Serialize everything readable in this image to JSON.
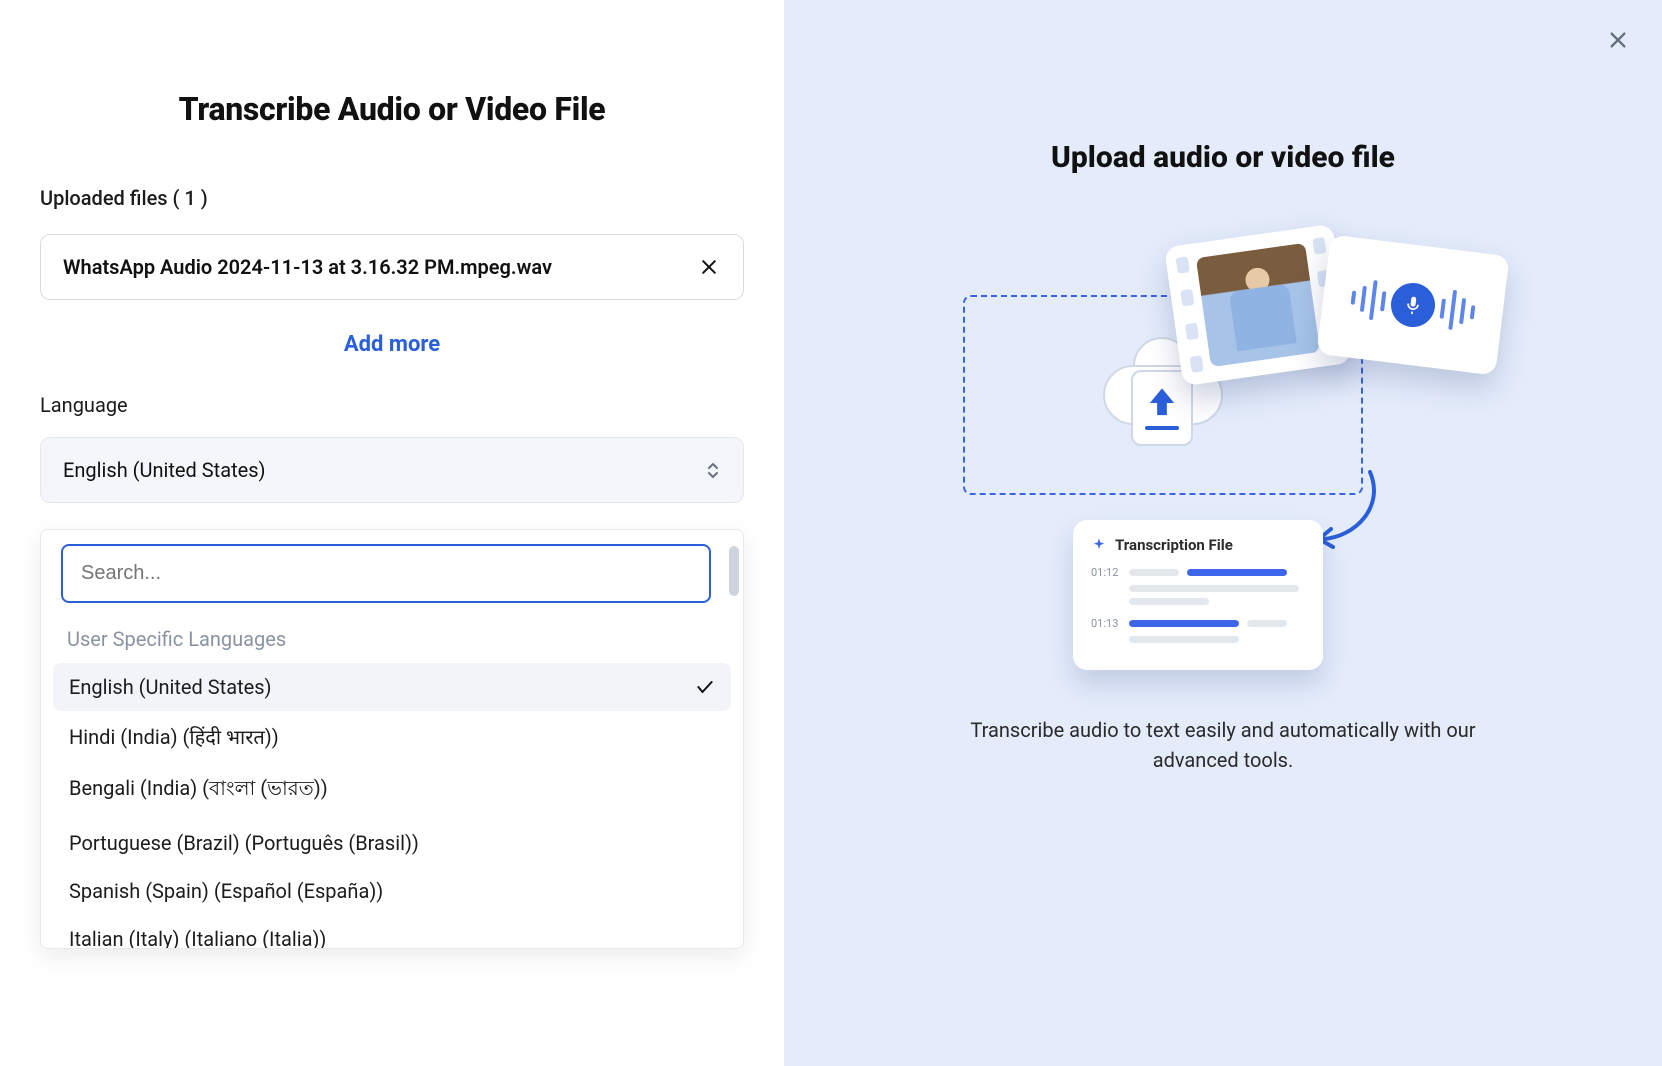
{
  "left": {
    "title": "Transcribe Audio or Video File",
    "uploaded_label": "Uploaded files ( 1 )",
    "file_name": "WhatsApp Audio 2024-11-13 at 3.16.32 PM.mpeg.wav",
    "add_more": "Add more",
    "language_label": "Language",
    "selected_language": "English (United States)",
    "search_placeholder": "Search...",
    "group_label": "User Specific Languages",
    "options": [
      {
        "label": "English (United States)",
        "selected": true
      },
      {
        "label": "Hindi (India) (हिंदी भारत))",
        "selected": false
      },
      {
        "label": "Bengali (India) (বাংলা (ভারত))",
        "selected": false
      },
      {
        "label": "Portuguese (Brazil) (Português (Brasil))",
        "selected": false
      },
      {
        "label": "Spanish (Spain) (Español (España))",
        "selected": false
      },
      {
        "label": "Italian (Italy) (Italiano (Italia))",
        "selected": false
      }
    ]
  },
  "right": {
    "title": "Upload audio or video file",
    "transcription_card_title": "Transcription File",
    "time1": "01:12",
    "time2": "01:13",
    "description": "Transcribe audio to text easily and automatically with our advanced tools."
  }
}
